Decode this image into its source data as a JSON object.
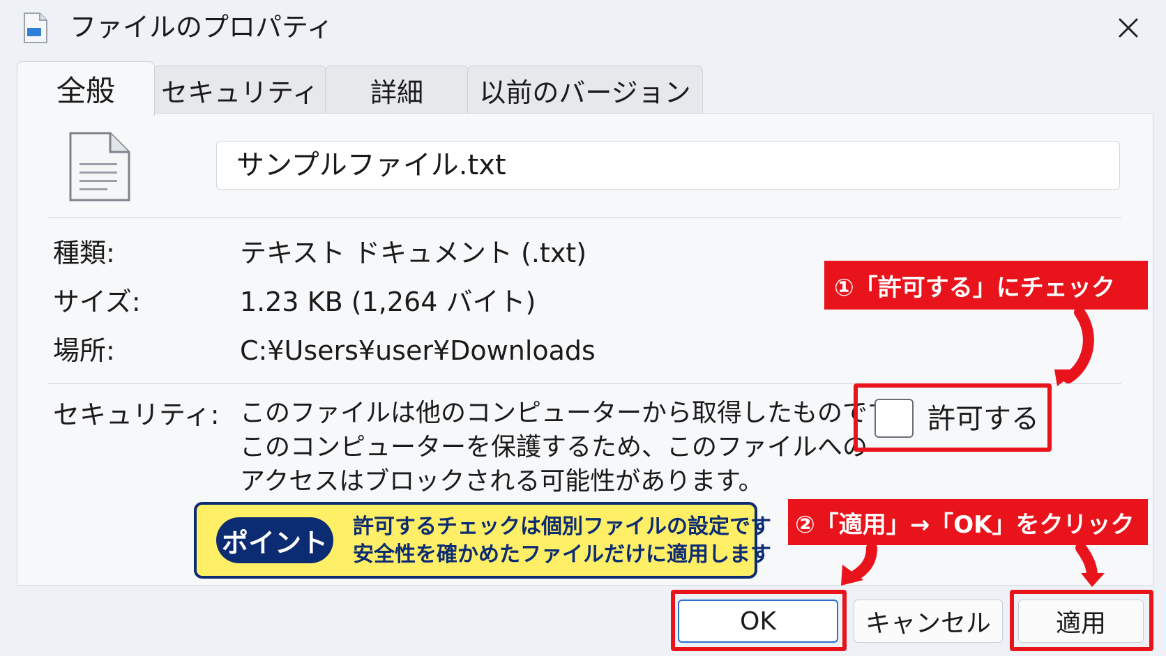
{
  "window": {
    "title": "ファイルのプロパティ"
  },
  "tabs": [
    {
      "label": "全般",
      "active": true
    },
    {
      "label": "セキュリティ",
      "active": false
    },
    {
      "label": "詳細",
      "active": false
    },
    {
      "label": "以前のバージョン",
      "active": false
    }
  ],
  "general": {
    "file_name": "サンプルファイル.txt",
    "rows": [
      {
        "label": "種類:",
        "value": "テキスト ドキュメント (.txt)"
      },
      {
        "label": "サイズ:",
        "value": "1.23 KB (1,264 バイト)"
      },
      {
        "label": "場所:",
        "value": "C:¥Users¥user¥Downloads"
      }
    ],
    "security": {
      "label": "セキュリティ:",
      "lines": [
        "このファイルは他のコンピューターから取得したものです。",
        "このコンピューターを保護するため、このファイルへの",
        "アクセスはブロックされる可能性があります。"
      ],
      "unblock_label": "許可する",
      "unblock_checked": false
    }
  },
  "annotations": {
    "step1": "①「許可する」にチェック",
    "step2": "②「適用」→「OK」をクリック",
    "point_badge": "ポイント",
    "point_lines": [
      "許可するチェックは個別ファイルの設定です",
      "安全性を確かめたファイルだけに適用します"
    ],
    "highlight_color": "#e8131b",
    "point_bg": "#ffef66",
    "point_navy": "#0b2b73"
  },
  "buttons": {
    "ok": "OK",
    "cancel": "キャンセル",
    "apply": "適用"
  },
  "icons": {
    "title": "text-file-icon",
    "file": "text-file-icon",
    "close": "close-icon"
  }
}
